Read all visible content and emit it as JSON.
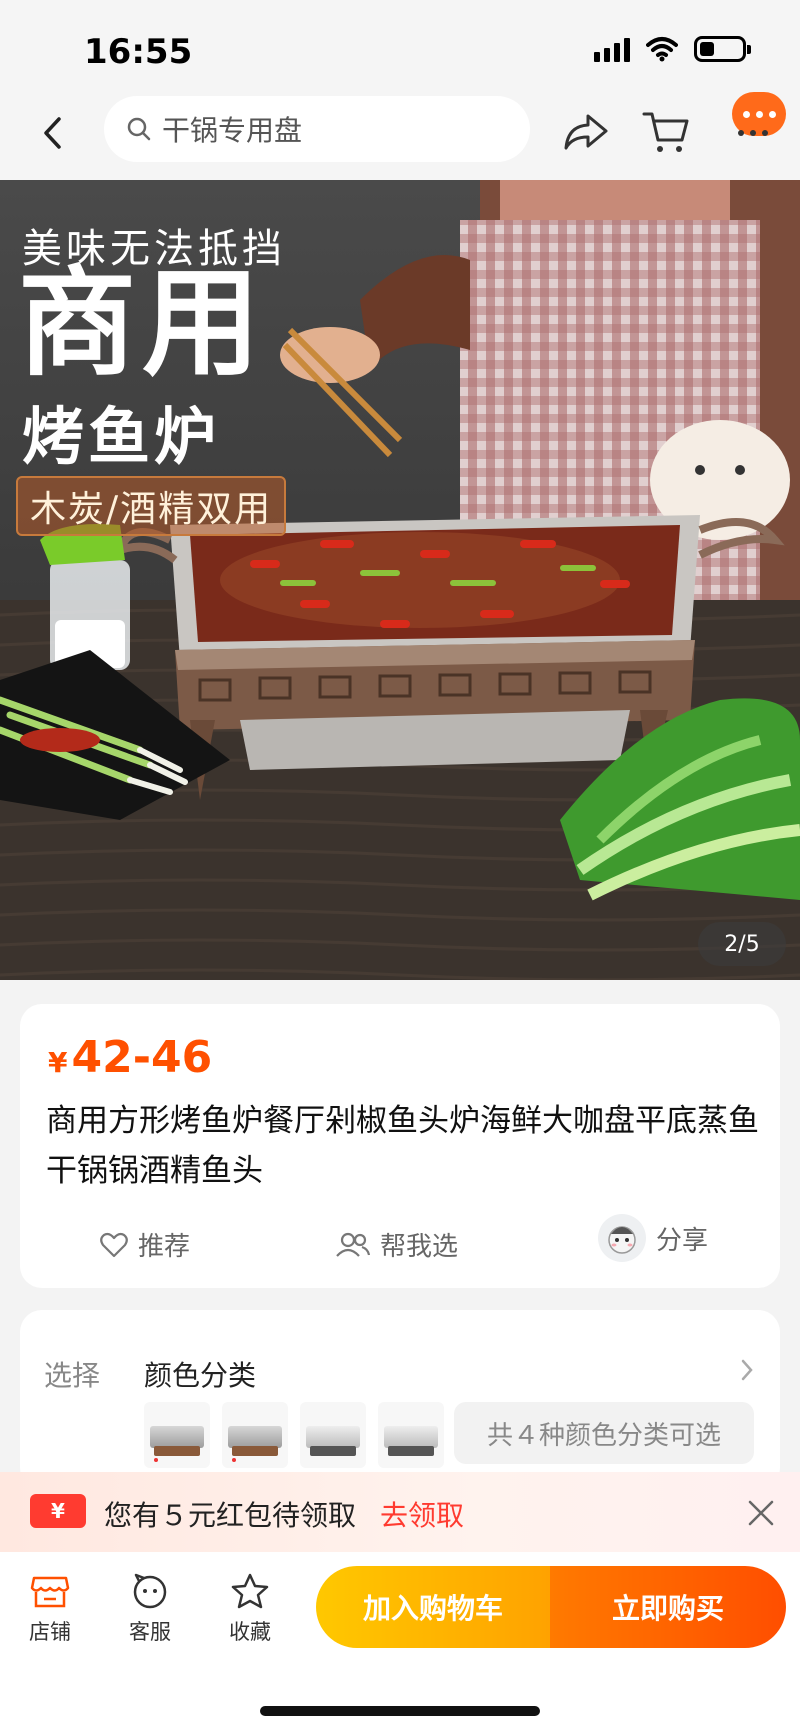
{
  "status": {
    "time": "16:55",
    "battery_level": 0.35
  },
  "nav": {
    "search_text": "干锅专用盘"
  },
  "hero": {
    "line1": "美味无法抵挡",
    "line2": "商用",
    "line3": "烤鱼炉",
    "tag": "木炭/酒精双用",
    "page_indicator": "2/5"
  },
  "product": {
    "price_symbol": "¥",
    "price_range": "42-46",
    "title": "商用方形烤鱼炉餐厅剁椒鱼头炉海鲜大咖盘平底蒸鱼干锅锅酒精鱼头",
    "actions": {
      "recommend": "推荐",
      "help_choose": "帮我选",
      "share": "分享"
    }
  },
  "options": {
    "label": "选择",
    "value": "颜色分类",
    "more": "共４种颜色分类可选"
  },
  "coupon": {
    "icon_text": "¥",
    "text": "您有５元红包待领取",
    "link": "去领取"
  },
  "bottom": {
    "shop": "店铺",
    "service": "客服",
    "favorite": "收藏",
    "add_cart": "加入购物车",
    "buy_now": "立即购买"
  },
  "colors": {
    "accent": "#ff5000",
    "cart_btn": "#ffb300",
    "buy_btn": "#ff5a00",
    "coupon_red": "#ff3b30"
  }
}
